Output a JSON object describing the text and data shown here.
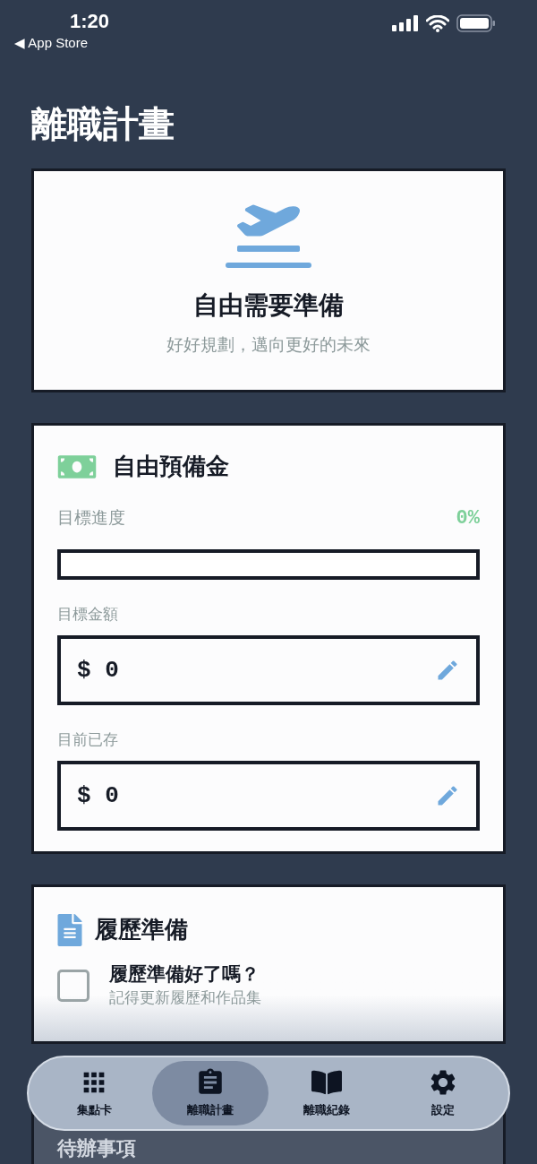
{
  "status_bar": {
    "time": "1:20",
    "back_label": "◀ App Store"
  },
  "page_title": "離職計畫",
  "hero": {
    "title": "自由需要準備",
    "subtitle": "好好規劃，邁向更好的未來"
  },
  "fund": {
    "title": "自由預備金",
    "progress_label": "目標進度",
    "progress_value": "0%",
    "level": 0,
    "fields": [
      {
        "label": "目標金額",
        "value": "$ 0"
      },
      {
        "label": "目前已存",
        "value": "$ 0"
      }
    ]
  },
  "resume": {
    "title": "履歷準備",
    "items": [
      {
        "title": "履歷準備好了嗎？",
        "subtitle": "記得更新履歷和作品集",
        "checked": false
      }
    ]
  },
  "todo": {
    "title": "待辦事項"
  },
  "tabs": [
    {
      "label": "集點卡",
      "kind": "grid",
      "selected": false
    },
    {
      "label": "離職計畫",
      "kind": "clipboard",
      "selected": true
    },
    {
      "label": "離職紀錄",
      "kind": "book",
      "selected": false
    },
    {
      "label": "設定",
      "kind": "gear",
      "selected": false
    }
  ]
}
